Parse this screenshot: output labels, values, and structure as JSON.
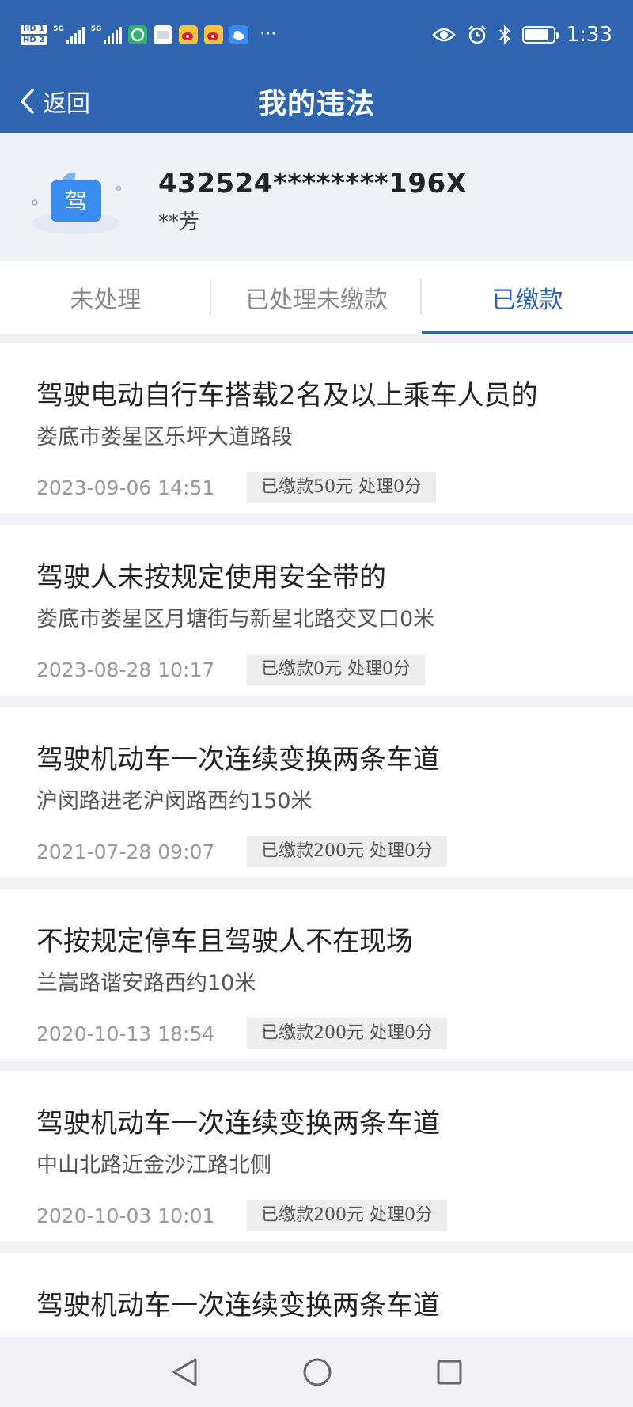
{
  "status": {
    "hd_labels": [
      "HD 1",
      "HD 2"
    ],
    "network": [
      "5G",
      "5G"
    ],
    "time": "1:33",
    "battery_level": 0.85
  },
  "nav": {
    "back_label": "返回",
    "title": "我的违法"
  },
  "license": {
    "icon_char": "驾",
    "number": "432524********196X",
    "name": "**芳"
  },
  "tabs": [
    {
      "label": "未处理"
    },
    {
      "label": "已处理未缴款"
    },
    {
      "label": "已缴款"
    }
  ],
  "active_tab": 2,
  "records": [
    {
      "title": "驾驶电动自行车搭载2名及以上乘车人员的",
      "location": "娄底市娄星区乐坪大道路段",
      "datetime": "2023-09-06 14:51",
      "status": "已缴款50元 处理0分"
    },
    {
      "title": "驾驶人未按规定使用安全带的",
      "location": "娄底市娄星区月塘街与新星北路交叉口0米",
      "datetime": "2023-08-28 10:17",
      "status": "已缴款0元 处理0分"
    },
    {
      "title": "驾驶机动车一次连续变换两条车道",
      "location": "沪闵路进老沪闵路西约150米",
      "datetime": "2021-07-28 09:07",
      "status": "已缴款200元 处理0分"
    },
    {
      "title": "不按规定停车且驾驶人不在现场",
      "location": "兰嵩路谐安路西约10米",
      "datetime": "2020-10-13 18:54",
      "status": "已缴款200元 处理0分"
    },
    {
      "title": "驾驶机动车一次连续变换两条车道",
      "location": "中山北路近金沙江路北侧",
      "datetime": "2020-10-03 10:01",
      "status": "已缴款200元 处理0分"
    },
    {
      "title": "驾驶机动车一次连续变换两条车道",
      "location": "",
      "datetime": "",
      "status": ""
    }
  ],
  "colors": {
    "primary": "#2e64b0",
    "background": "#f2f2f6",
    "badge_bg": "#eeeeee"
  },
  "icons": [
    "back-chevron-icon",
    "driver-license-icon",
    "eye-icon",
    "alarm-icon",
    "bluetooth-icon",
    "battery-icon",
    "nav-back-icon",
    "nav-home-icon",
    "nav-recents-icon"
  ]
}
